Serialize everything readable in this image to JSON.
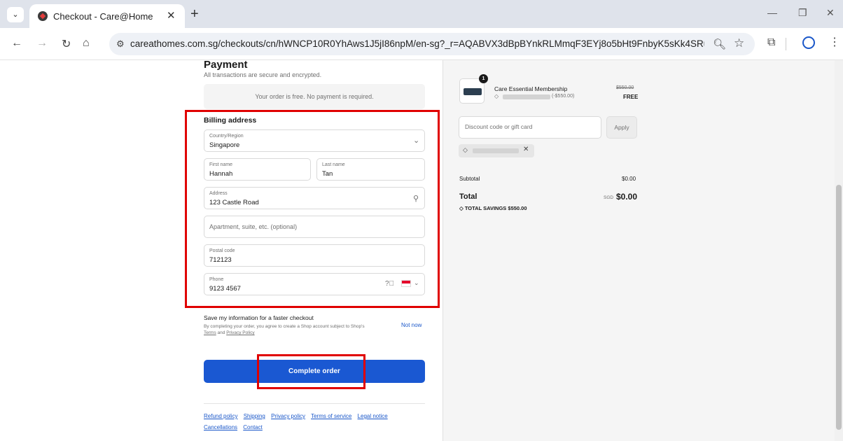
{
  "browser": {
    "tab_title": "Checkout - Care@Home",
    "url": "careathomes.com.sg/checkouts/cn/hWNCP10R0YhAws1J5jI86npM/en-sg?_r=AQABVX3dBpBYnkRLMmqF3EYj8o5bHt9FnbyK5sKk4SRutTM&...",
    "icons": [
      "chevron-down-icon",
      "favicon",
      "close-icon",
      "plus-icon",
      "minimize-icon",
      "restore-icon",
      "window-close-icon",
      "back-icon",
      "forward-icon",
      "reload-icon",
      "home-icon",
      "site-info-icon",
      "zoom-icon",
      "star-icon",
      "extensions-icon",
      "profile-icon",
      "menu-icon"
    ]
  },
  "payment": {
    "title": "Payment",
    "subtitle": "All transactions are secure and encrypted.",
    "free_message": "Your order is free. No payment is required."
  },
  "billing": {
    "title": "Billing address",
    "country_label": "Country/Region",
    "country_value": "Singapore",
    "first_name_label": "First name",
    "first_name_value": "Hannah",
    "last_name_label": "Last name",
    "last_name_value": "Tan",
    "address_label": "Address",
    "address_value": "123 Castle Road",
    "apartment_placeholder": "Apartment, suite, etc. (optional)",
    "postal_label": "Postal code",
    "postal_value": "712123",
    "phone_label": "Phone",
    "phone_value": "9123 4567"
  },
  "save_info": {
    "title": "Save my information for a faster checkout",
    "text_prefix": "By completing your order, you agree to create a Shop account subject to Shop's",
    "terms": "Terms",
    "and": "and",
    "privacy": "Privacy Policy",
    "not_now": "Not now"
  },
  "complete_button": "Complete order",
  "footer_links": [
    "Refund policy",
    "Shipping",
    "Privacy policy",
    "Terms of service",
    "Legal notice",
    "Cancellations",
    "Contact"
  ],
  "summary": {
    "qty": "1",
    "product_name": "Care Essential Membership",
    "discount_amount": "(-$550.00)",
    "original_price": "$550.00",
    "price": "FREE",
    "discount_placeholder": "Discount code or gift card",
    "apply_label": "Apply",
    "subtotal_label": "Subtotal",
    "subtotal_value": "$0.00",
    "total_label": "Total",
    "total_currency": "SGD",
    "total_value": "$0.00",
    "savings_text": "TOTAL SAVINGS $550.00"
  },
  "colors": {
    "accent": "#1a58d2",
    "highlight": "#e00000"
  }
}
